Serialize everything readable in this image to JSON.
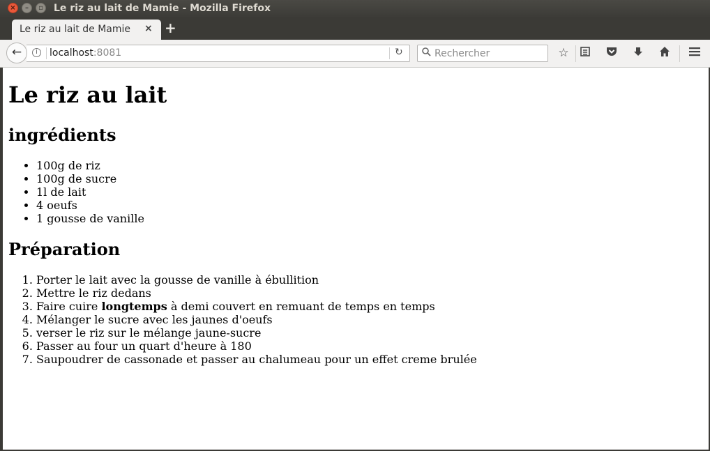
{
  "window": {
    "title": "Le riz au lait de Mamie - Mozilla Firefox"
  },
  "tab": {
    "title": "Le riz au lait de Mamie",
    "close_label": "×",
    "new_tab_label": "+"
  },
  "navbar": {
    "url_host": "localhost",
    "url_port": ":8081",
    "search_placeholder": "Rechercher"
  },
  "page": {
    "title": "Le riz au lait",
    "ingredients_heading": "ingrédients",
    "ingredients": [
      "100g de riz",
      "100g de sucre",
      "1l de lait",
      "4 oeufs",
      "1 gousse de vanille"
    ],
    "preparation_heading": "Préparation",
    "steps": [
      "Porter le lait avec la gousse de vanille à ébullition",
      "Mettre le riz dedans",
      {
        "before": "Faire cuire ",
        "bold": "longtemps",
        "after": " à demi couvert en remuant de temps en temps"
      },
      "Mélanger le sucre avec les jaunes d'oeufs",
      "verser le riz sur le mélange jaune-sucre",
      "Passer au four un quart d'heure à 180",
      "Saupoudrer de cassonade et passer au chalumeau pour un effet creme brulée"
    ]
  }
}
